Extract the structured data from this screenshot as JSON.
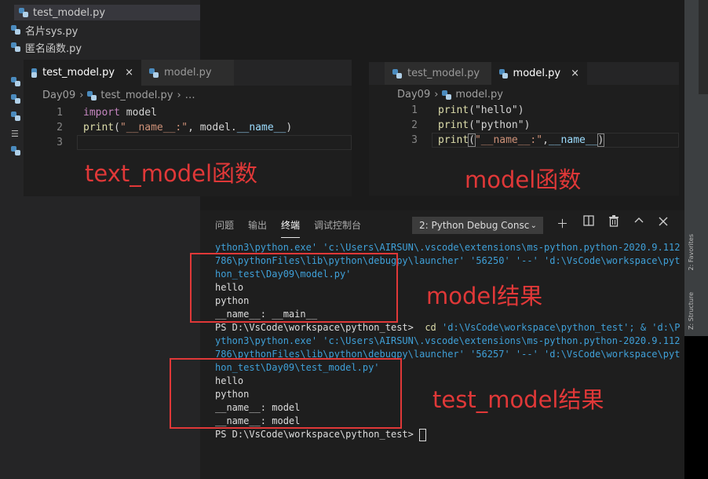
{
  "explorer": {
    "items": [
      {
        "label": "test_model.py"
      },
      {
        "label": "名片sys.py"
      },
      {
        "label": "匿名函数.py"
      }
    ]
  },
  "left_editor": {
    "tabs": [
      {
        "label": "test_model.py",
        "close": "×"
      },
      {
        "label": "model.py"
      }
    ],
    "breadcrumb": {
      "folder": "Day09",
      "sep": "›",
      "file": "test_model.py",
      "more": "…"
    },
    "line_numbers": [
      "1",
      "2",
      "3"
    ],
    "code": {
      "l1_kw": "import",
      "l1_rest": " model",
      "l2_fn": "print",
      "l2_p1": "(",
      "l2_str": "\"__name__:\"",
      "l2_comma": ", model.",
      "l2_var": "__name__",
      "l2_p2": ")"
    }
  },
  "right_editor": {
    "tabs": [
      {
        "label": "test_model.py"
      },
      {
        "label": "model.py",
        "close": "×"
      }
    ],
    "breadcrumb": {
      "folder": "Day09",
      "sep": "›",
      "file": "model.py"
    },
    "line_numbers": [
      "1",
      "2",
      "3"
    ],
    "code": {
      "l1_fn": "print",
      "l1_str": "(\"hello\")",
      "l2_fn": "print",
      "l2_str": "(\"python\")",
      "l3_fn": "print",
      "l3_p1": "(",
      "l3_str": "\"__name__:\"",
      "l3_comma": ",",
      "l3_var": "__name__",
      "l3_p2": ")"
    }
  },
  "annotations": {
    "left_label": "text_model函数",
    "right_label": "model函数",
    "model_result": "model结果",
    "test_model_result": "test_model结果"
  },
  "terminal": {
    "tabs": [
      "问题",
      "输出",
      "终端",
      "调试控制台"
    ],
    "active_tab": "终端",
    "select_value": "2: Python Debug Consc",
    "icons": [
      "plus-icon",
      "split-icon",
      "trash-icon",
      "chevron-up-icon",
      "close-icon"
    ],
    "lines": [
      {
        "text": "ython3\\python.exe' 'c:\\Users\\AIRSUN\\.vscode\\extensions\\ms-python.python-2020.9.112",
        "style": "cyan"
      },
      {
        "text": "786\\pythonFiles\\lib\\python\\debugpy\\launcher' '56250' '--' 'd:\\VsCode\\workspace\\pyt",
        "style": "cyan"
      },
      {
        "text": "hon_test\\Day09\\model.py'",
        "style": "cyan"
      },
      {
        "text": "hello",
        "style": "white"
      },
      {
        "text": "python",
        "style": "white"
      },
      {
        "text": "__name__: __main__",
        "style": "white"
      },
      {
        "text": "PS D:\\VsCode\\workspace\\python_test>  cd 'd:\\VsCode\\workspace\\python_test'; & 'd:\\P",
        "style": "prompt"
      },
      {
        "text": "ython3\\python.exe' 'c:\\Users\\AIRSUN\\.vscode\\extensions\\ms-python.python-2020.9.112",
        "style": "cyan"
      },
      {
        "text": "786\\pythonFiles\\lib\\python\\debugpy\\launcher' '56257' '--' 'd:\\VsCode\\workspace\\pyt",
        "style": "cyan"
      },
      {
        "text": "hon_test\\Day09\\test_model.py'",
        "style": "cyan"
      },
      {
        "text": "hello",
        "style": "white"
      },
      {
        "text": "python",
        "style": "white"
      },
      {
        "text": "__name__: model",
        "style": "white"
      },
      {
        "text": "__name__: model",
        "style": "white"
      },
      {
        "text": "PS D:\\VsCode\\workspace\\python_test> ",
        "style": "white"
      }
    ],
    "prompt_cmd": {
      "ps": "PS D:\\VsCode\\workspace\\python_test>  ",
      "cd": "cd",
      "rest": " 'd:\\VsCode\\workspace\\python_test'; & 'd:\\P"
    }
  },
  "right_strip": {
    "favorites": "2: Favorites",
    "structure": "Z: Structure"
  }
}
